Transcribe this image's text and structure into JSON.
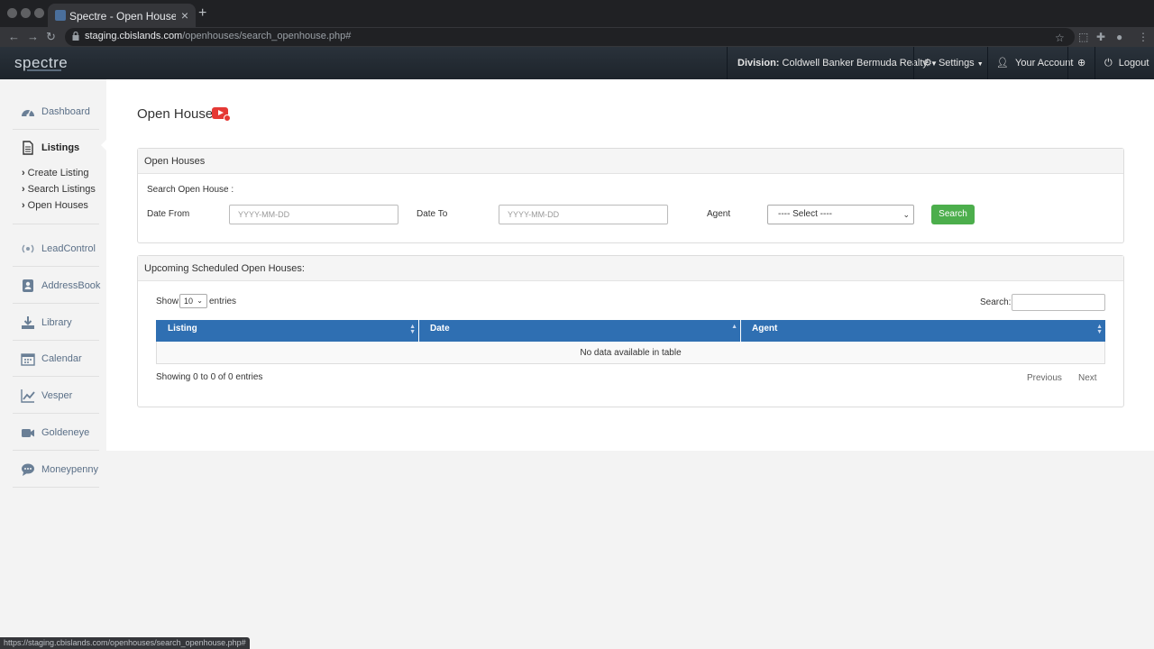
{
  "browser": {
    "tab_title": "Spectre - Open Houses / Open Houses",
    "url_host": "staging.cbislands.com",
    "url_path": "/openhouses/search_openhouse.php#",
    "status_url": "https://staging.cbislands.com/openhouses/search_openhouse.php#"
  },
  "header": {
    "logo": "spectre",
    "division_label": "Division:",
    "division_value": "Coldwell Banker Bermuda Realty",
    "settings": "Settings",
    "account": "Your Account",
    "logout": "Logout"
  },
  "sidebar": {
    "dashboard": "Dashboard",
    "listings": "Listings",
    "sub": [
      "Create Listing",
      "Search Listings",
      "Open Houses"
    ],
    "leadcontrol": "LeadControl",
    "addressbook": "AddressBook",
    "library": "Library",
    "calendar": "Calendar",
    "vesper": "Vesper",
    "goldeneye": "Goldeneye",
    "moneypenny": "Moneypenny"
  },
  "page": {
    "title": "Open Houses"
  },
  "search_panel": {
    "heading": "Open Houses",
    "subheading": "Search Open House :",
    "date_from_label": "Date From",
    "date_from_placeholder": "YYYY-MM-DD",
    "date_to_label": "Date To",
    "date_to_placeholder": "YYYY-MM-DD",
    "agent_label": "Agent",
    "agent_selected": "---- Select ----",
    "search_button": "Search"
  },
  "upcoming_panel": {
    "heading": "Upcoming Scheduled Open Houses:",
    "show_label": "Show",
    "entries_value": "10",
    "entries_label": "entries",
    "search_label": "Search:",
    "columns": [
      "Listing",
      "Date",
      "Agent"
    ],
    "empty_message": "No data available in table",
    "info": "Showing 0 to 0 of 0 entries",
    "previous": "Previous",
    "next": "Next"
  },
  "colors": {
    "table_header": "#2f6fb2",
    "search_button": "#4cae4c",
    "header_bg": "#1d242b"
  }
}
